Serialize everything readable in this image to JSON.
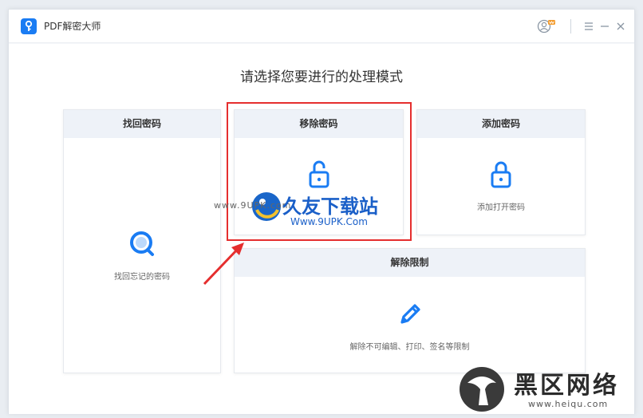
{
  "window": {
    "title": "PDF解密大师",
    "heading": "请选择您要进行的处理模式"
  },
  "cards": {
    "recover": {
      "title": "找回密码",
      "desc": "找回忘记的密码"
    },
    "remove": {
      "title": "移除密码",
      "desc": ""
    },
    "add": {
      "title": "添加密码",
      "desc": "添加打开密码"
    },
    "unlock": {
      "title": "解除限制",
      "desc": "解除不可编辑、打印、签名等限制"
    }
  },
  "watermark": {
    "small_text": "www.9UPK.com",
    "big_text": "久友下载站",
    "url_text": "Www.9UPK.Com"
  },
  "corner_watermark": {
    "title": "黑区网络",
    "url": "www.heiqu.com"
  },
  "colors": {
    "accent": "#1a7cf3",
    "highlight": "#e52e2e",
    "card_header_bg": "#eef2f8"
  }
}
